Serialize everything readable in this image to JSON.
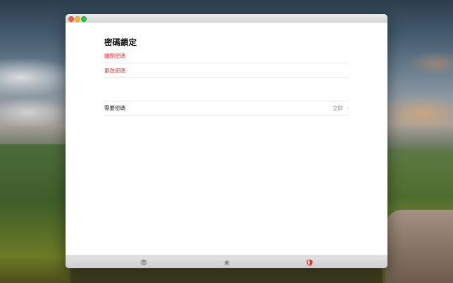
{
  "window": {
    "traffic_lights": [
      "close",
      "minimize",
      "zoom"
    ]
  },
  "page": {
    "title": "密碼鎖定"
  },
  "actions": [
    {
      "label": "關閉密碼",
      "color": "#e0312f"
    },
    {
      "label": "更改密碼",
      "color": "#e0312f"
    }
  ],
  "settings": {
    "require_password": {
      "label": "需要密碼",
      "value": "立即",
      "chevron": "›"
    }
  },
  "tabbar": {
    "tabs": [
      {
        "icon": "stack-icon",
        "selected": false
      },
      {
        "icon": "star-icon",
        "selected": false
      },
      {
        "icon": "shield-icon",
        "selected": true,
        "accent": "#e0312f"
      }
    ]
  }
}
